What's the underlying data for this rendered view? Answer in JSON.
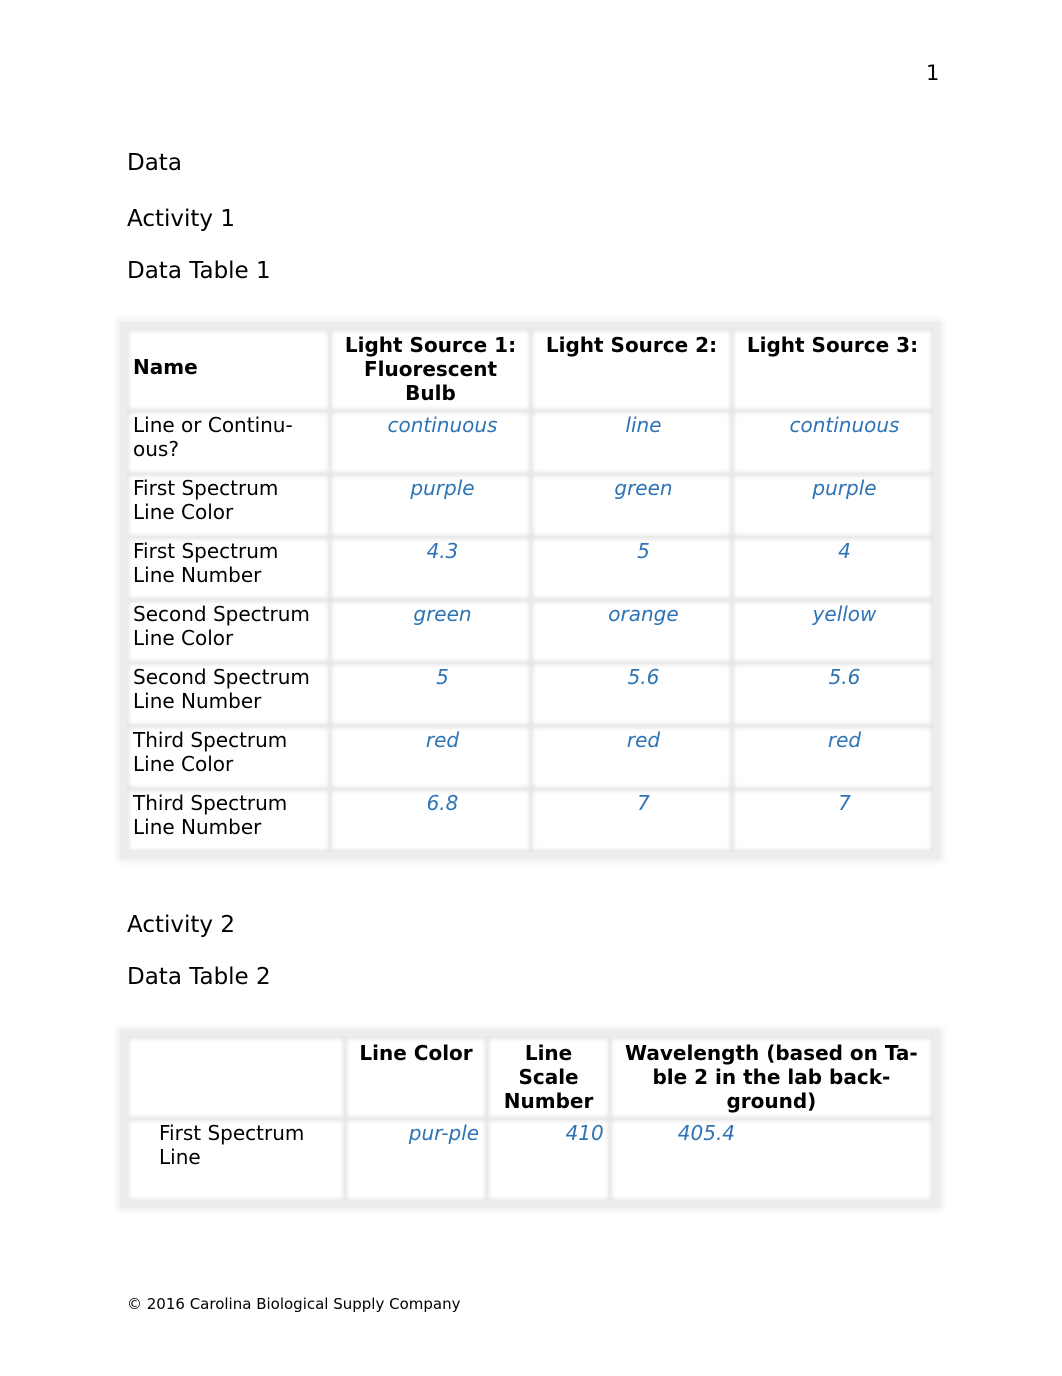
{
  "page_number": "1",
  "headings": {
    "data": "Data",
    "activity1": "Activity 1",
    "table1_title": "Data Table 1",
    "activity2": "Activity 2",
    "table2_title": "Data Table 2"
  },
  "table1": {
    "headers": [
      "Name",
      "Light Source 1: Fluorescent Bulb",
      "Light Source 2:",
      "Light Source 3:"
    ],
    "rows": [
      {
        "label": "Line or Continu-ous?",
        "values": [
          "continuous",
          "line",
          "continuous"
        ]
      },
      {
        "label": "First Spectrum Line Color",
        "values": [
          "purple",
          "green",
          "purple"
        ]
      },
      {
        "label": "First Spectrum Line Number",
        "values": [
          "4.3",
          "5",
          "4"
        ]
      },
      {
        "label": "Second Spectrum Line Color",
        "values": [
          "green",
          "orange",
          "yellow"
        ]
      },
      {
        "label": "Second Spectrum Line Number",
        "values": [
          "5",
          "5.6",
          "5.6"
        ]
      },
      {
        "label": "Third Spectrum Line Color",
        "values": [
          "red",
          "red",
          "red"
        ]
      },
      {
        "label": "Third Spectrum Line Number",
        "values": [
          "6.8",
          "7",
          "7"
        ]
      }
    ]
  },
  "table2": {
    "headers": [
      "",
      "Line Color",
      "Line Scale Number",
      "Wavelength (based on Ta-ble 2 in the lab back-ground)"
    ],
    "rows": [
      {
        "label": "First Spectrum Line",
        "values": [
          "pur-ple",
          "410",
          "405.4"
        ]
      }
    ]
  },
  "footer": "© 2016 Carolina Biological Supply Company",
  "colors": {
    "entry_text": "#2e74b5"
  }
}
